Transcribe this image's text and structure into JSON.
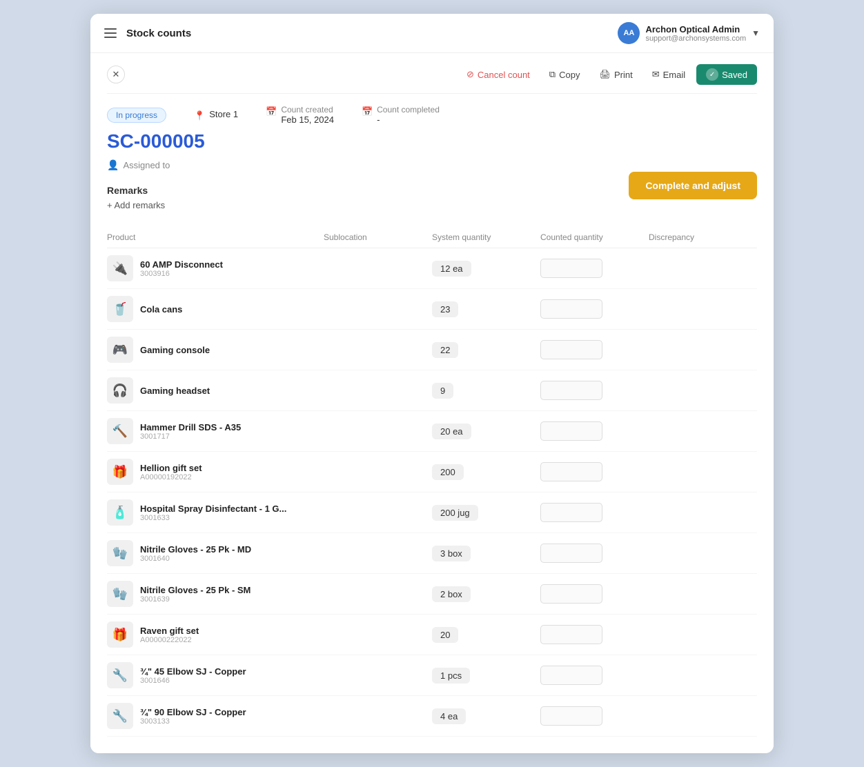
{
  "app": {
    "title": "Stock counts"
  },
  "user": {
    "initials": "AA",
    "name": "Archon Optical Admin",
    "email": "support@archonsystems.com"
  },
  "actions": {
    "cancel_label": "Cancel count",
    "copy_label": "Copy",
    "print_label": "Print",
    "email_label": "Email",
    "saved_label": "Saved",
    "complete_label": "Complete and adjust"
  },
  "record": {
    "status": "In progress",
    "store": "Store 1",
    "count_created_label": "Count created",
    "count_created_date": "Feb 15, 2024",
    "count_completed_label": "Count completed",
    "count_completed_value": "-",
    "sc_number": "SC-000005",
    "assigned_label": "Assigned to"
  },
  "remarks": {
    "title": "Remarks",
    "add_label": "+ Add remarks"
  },
  "table": {
    "columns": {
      "product": "Product",
      "sublocation": "Sublocation",
      "system_quantity": "System quantity",
      "counted_quantity": "Counted quantity",
      "discrepancy": "Discrepancy"
    },
    "rows": [
      {
        "name": "60 AMP Disconnect",
        "sku": "3003916",
        "qty": "12 ea",
        "icon": "🔌"
      },
      {
        "name": "Cola cans",
        "sku": "",
        "qty": "23",
        "icon": "🥤"
      },
      {
        "name": "Gaming console",
        "sku": "",
        "qty": "22",
        "icon": "🎮"
      },
      {
        "name": "Gaming headset",
        "sku": "",
        "qty": "9",
        "icon": "🎧"
      },
      {
        "name": "Hammer Drill SDS - A35",
        "sku": "3001717",
        "qty": "20 ea",
        "icon": "🔨"
      },
      {
        "name": "Hellion gift set",
        "sku": "A00000192022",
        "qty": "200",
        "icon": "🎁"
      },
      {
        "name": "Hospital Spray Disinfectant - 1 G...",
        "sku": "3001633",
        "qty": "200 jug",
        "icon": "🧴"
      },
      {
        "name": "Nitrile Gloves - 25 Pk - MD",
        "sku": "3001640",
        "qty": "3 box",
        "icon": "🧤"
      },
      {
        "name": "Nitrile Gloves - 25 Pk - SM",
        "sku": "3001639",
        "qty": "2 box",
        "icon": "🧤"
      },
      {
        "name": "Raven gift set",
        "sku": "A00000222022",
        "qty": "20",
        "icon": "🎁"
      },
      {
        "name": "¾\" 45 Elbow SJ - Copper",
        "sku": "3001646",
        "qty": "1 pcs",
        "icon": "🔧"
      },
      {
        "name": "¾\" 90 Elbow SJ - Copper",
        "sku": "3003133",
        "qty": "4 ea",
        "icon": "🔧"
      }
    ]
  }
}
